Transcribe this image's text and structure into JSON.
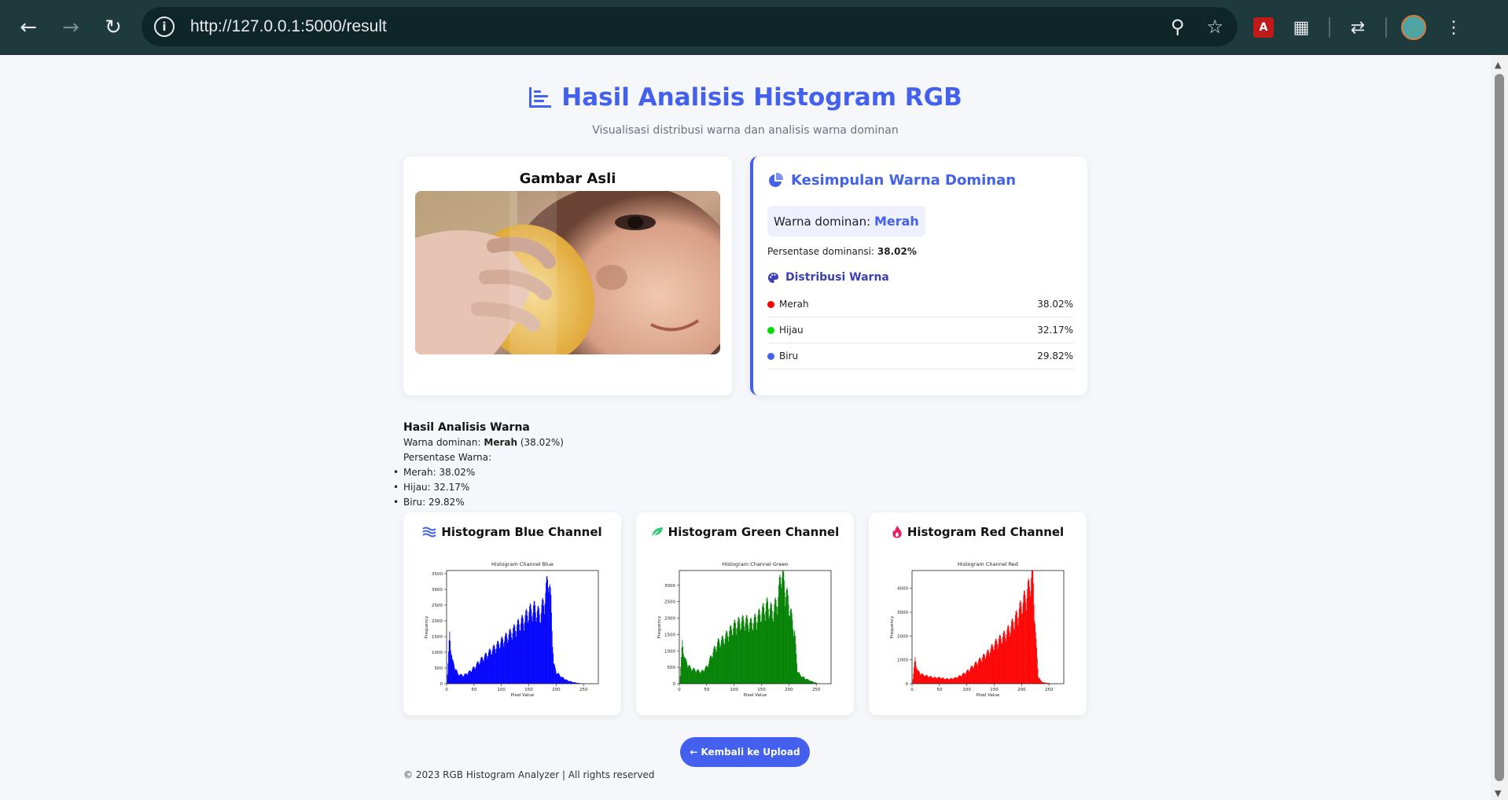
{
  "browser": {
    "url": "http://127.0.0.1:5000/result"
  },
  "header": {
    "title": "Hasil Analisis Histogram RGB",
    "subtitle": "Visualisasi distribusi warna dan analisis warna dominan"
  },
  "image_card": {
    "title": "Gambar Asli"
  },
  "summary": {
    "title": "Kesimpulan Warna Dominan",
    "dominant_label": "Warna dominan:",
    "dominant_value": "Merah",
    "percentage_label": "Persentase dominansi:",
    "percentage_value": "38.02%",
    "distribution_title": "Distribusi Warna",
    "distribution": [
      {
        "name": "Merah",
        "value": "38.02%",
        "color": "#ff0000"
      },
      {
        "name": "Hijau",
        "value": "32.17%",
        "color": "#00e000"
      },
      {
        "name": "Biru",
        "value": "29.82%",
        "color": "#4361ee"
      }
    ]
  },
  "results": {
    "heading": "Hasil Analisis Warna",
    "dominant_prefix": "Warna dominan:",
    "dominant_value": "Merah",
    "dominant_pct": "(38.02%)",
    "percent_heading": "Persentase Warna:",
    "items": [
      "Merah: 38.02%",
      "Hijau: 32.17%",
      "Biru: 29.82%"
    ]
  },
  "histograms": [
    {
      "title": "Histogram Blue Channel",
      "chart_title": "Histogram Channel Blue",
      "color": "#0000ff",
      "icon_color": "#4361ee",
      "yticks": [
        "0",
        "500",
        "1000",
        "1500",
        "2000",
        "2500",
        "3000",
        "3500"
      ],
      "ymax": 3600
    },
    {
      "title": "Histogram Green Channel",
      "chart_title": "Histogram Channel Green",
      "color": "#008000",
      "icon_color": "#2ecc71",
      "yticks": [
        "0",
        "500",
        "1000",
        "1500",
        "2000",
        "2500",
        "3000"
      ],
      "ymax": 3450
    },
    {
      "title": "Histogram Red Channel",
      "chart_title": "Histogram Channel Red",
      "color": "#ff0000",
      "icon_color": "#e91e63",
      "yticks": [
        "0",
        "1000",
        "2000",
        "3000",
        "4000"
      ],
      "ymax": 4750
    }
  ],
  "chart_common": {
    "xticks": [
      "0",
      "50",
      "100",
      "150",
      "200",
      "250"
    ],
    "xlabel": "Pixel Value",
    "ylabel": "Frequency"
  },
  "chart_data": [
    {
      "type": "bar",
      "title": "Histogram Channel Blue",
      "xlabel": "Pixel Value",
      "ylabel": "Frequency",
      "x": [
        0,
        5,
        10,
        20,
        30,
        40,
        50,
        60,
        70,
        80,
        90,
        100,
        110,
        120,
        130,
        140,
        150,
        160,
        170,
        180,
        185,
        190,
        195,
        200,
        210,
        220,
        230,
        240,
        250,
        255
      ],
      "values": [
        0,
        1500,
        700,
        300,
        250,
        350,
        500,
        700,
        850,
        1000,
        1150,
        1300,
        1450,
        1600,
        1800,
        1950,
        2200,
        2300,
        2100,
        2700,
        3350,
        2500,
        600,
        350,
        200,
        100,
        50,
        20,
        0,
        0
      ],
      "xlim": [
        0,
        255
      ],
      "ylim": [
        0,
        3600
      ]
    },
    {
      "type": "bar",
      "title": "Histogram Channel Green",
      "xlabel": "Pixel Value",
      "ylabel": "Frequency",
      "x": [
        0,
        5,
        10,
        20,
        30,
        40,
        50,
        60,
        70,
        80,
        90,
        100,
        110,
        120,
        130,
        140,
        150,
        160,
        170,
        180,
        185,
        190,
        200,
        210,
        215,
        220,
        230,
        240,
        250,
        255
      ],
      "values": [
        0,
        1200,
        700,
        450,
        400,
        350,
        500,
        900,
        1200,
        1300,
        1500,
        1700,
        1800,
        1850,
        1750,
        1900,
        2100,
        2300,
        2100,
        2500,
        3300,
        3000,
        2300,
        1500,
        400,
        250,
        150,
        80,
        20,
        0
      ],
      "xlim": [
        0,
        255
      ],
      "ylim": [
        0,
        3450
      ]
    },
    {
      "type": "bar",
      "title": "Histogram Channel Red",
      "xlabel": "Pixel Value",
      "ylabel": "Frequency",
      "x": [
        0,
        5,
        10,
        20,
        30,
        40,
        50,
        60,
        70,
        80,
        90,
        100,
        110,
        120,
        130,
        140,
        150,
        160,
        170,
        180,
        190,
        200,
        210,
        220,
        225,
        230,
        235,
        240,
        250,
        255
      ],
      "values": [
        0,
        1000,
        500,
        350,
        300,
        250,
        250,
        200,
        200,
        250,
        350,
        500,
        700,
        900,
        1100,
        1300,
        1600,
        1800,
        2000,
        2300,
        2700,
        3200,
        3700,
        4500,
        2000,
        300,
        100,
        50,
        20,
        0
      ],
      "xlim": [
        0,
        255
      ],
      "ylim": [
        0,
        4750
      ]
    }
  ],
  "footer": {
    "back_button": "Kembali ke Upload",
    "copyright": "© 2023 RGB Histogram Analyzer | All rights reserved"
  }
}
